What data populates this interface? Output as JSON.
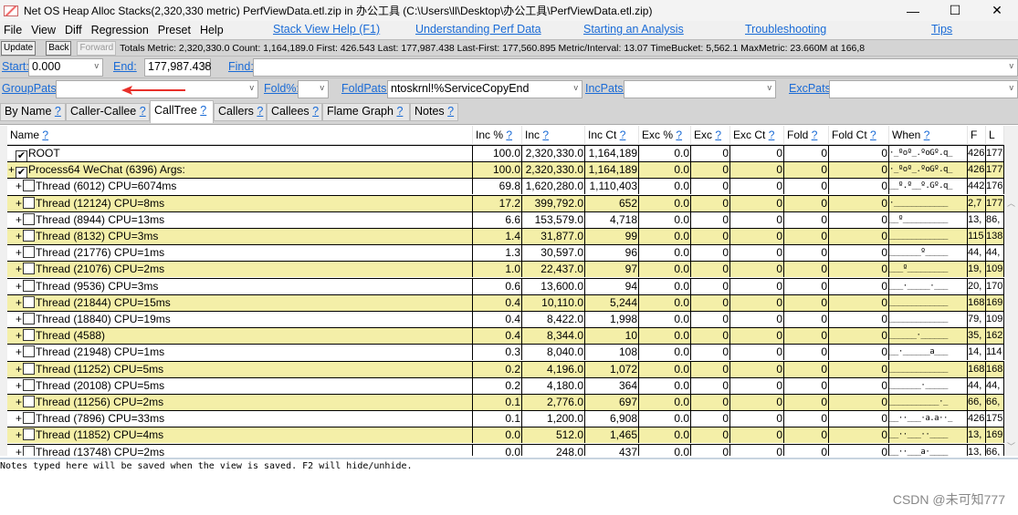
{
  "window": {
    "title": "Net OS Heap Alloc Stacks(2,320,330 metric) PerfViewData.etl.zip in 办公工具 (C:\\Users\\ll\\Desktop\\办公工具\\PerfViewData.etl.zip)",
    "minimize": "—",
    "maximize": "☐",
    "close": "✕"
  },
  "menu": {
    "items": [
      "File",
      "View",
      "Diff",
      "Regression",
      "Preset",
      "Help"
    ],
    "links": [
      "Stack View Help (F1)",
      "Understanding Perf Data",
      "Starting an Analysis",
      "Troubleshooting",
      "Tips"
    ]
  },
  "toolbar": {
    "update": "Update",
    "back": "Back",
    "forward": "Forward",
    "totals": "Totals Metric: 2,320,330.0  Count: 1,164,189.0  First: 426.543 Last: 177,987.438  Last-First: 177,560.895  Metric/Interval: 13.07  TimeBucket: 5,562.1 MaxMetric: 23.660M at 166,8"
  },
  "filters": {
    "start_label": "Start:",
    "start_value": "0.000",
    "end_label": "End:",
    "end_value": "177,987.438",
    "find_label": "Find:",
    "find_value": "",
    "grouppats_label": "GroupPats:",
    "grouppats_value": "",
    "fold_label": "Fold%:",
    "fold_value": "",
    "foldpats_label": "FoldPats:",
    "foldpats_value": "ntoskrnl!%ServiceCopyEnd",
    "incpats_label": "IncPats:",
    "incpats_value": "",
    "excpats_label": "ExcPats:",
    "excpats_value": ""
  },
  "tabs": [
    {
      "label": "By Name"
    },
    {
      "label": "Caller-Callee"
    },
    {
      "label": "CallTree",
      "active": true
    },
    {
      "label": "Callers"
    },
    {
      "label": "Callees"
    },
    {
      "label": "Flame Graph"
    },
    {
      "label": "Notes"
    }
  ],
  "help_mark": "?",
  "columns": [
    "Name",
    "Inc %",
    "Inc",
    "Inc Ct",
    "Exc %",
    "Exc",
    "Exc Ct",
    "Fold",
    "Fold Ct",
    "When",
    "F",
    "L"
  ],
  "rows": [
    {
      "exp": "",
      "checked": true,
      "indent": 0,
      "name": "ROOT",
      "inc_pct": "100.0",
      "inc": "2,320,330.0",
      "inc_ct": "1,164,189",
      "when": "·_ºoº_.ºoGº.q_",
      "f": "426",
      "l": "177"
    },
    {
      "exp": "+",
      "checked": true,
      "indent": 0,
      "name": "Process64 WeChat (6396) Args:",
      "inc_pct": "100.0",
      "inc": "2,320,330.0",
      "inc_ct": "1,164,189",
      "when": "·_ºoº_.ºoGº.q_",
      "f": "426",
      "l": "177"
    },
    {
      "exp": "+",
      "checked": false,
      "indent": 1,
      "name": "Thread (6012) CPU=6074ms",
      "inc_pct": "69.8",
      "inc": "1,620,280.0",
      "inc_ct": "1,110,403",
      "when": "__º.º__º.Gº.q_",
      "f": "442",
      "l": "176"
    },
    {
      "exp": "+",
      "checked": false,
      "indent": 1,
      "name": "Thread (12124) CPU=8ms",
      "inc_pct": "17.2",
      "inc": "399,792.0",
      "inc_ct": "652",
      "when": "·____________",
      "f": "2,7",
      "l": "177"
    },
    {
      "exp": "+",
      "checked": false,
      "indent": 1,
      "name": "Thread (8944) CPU=13ms",
      "inc_pct": "6.6",
      "inc": "153,579.0",
      "inc_ct": "4,718",
      "when": "__º__________",
      "f": "13,",
      "l": "86,"
    },
    {
      "exp": "+",
      "checked": false,
      "indent": 1,
      "name": "Thread (8132) CPU=3ms",
      "inc_pct": "1.4",
      "inc": "31,877.0",
      "inc_ct": "99",
      "when": "_____________",
      "f": "115",
      "l": "138"
    },
    {
      "exp": "+",
      "checked": false,
      "indent": 1,
      "name": "Thread (21776) CPU=1ms",
      "inc_pct": "1.3",
      "inc": "30,597.0",
      "inc_ct": "96",
      "when": "_______º_____",
      "f": "44,",
      "l": "44,"
    },
    {
      "exp": "+",
      "checked": false,
      "indent": 1,
      "name": "Thread (21076) CPU=2ms",
      "inc_pct": "1.0",
      "inc": "22,437.0",
      "inc_ct": "97",
      "when": "___º_________",
      "f": "19,",
      "l": "109"
    },
    {
      "exp": "+",
      "checked": false,
      "indent": 1,
      "name": "Thread (9536) CPU=3ms",
      "inc_pct": "0.6",
      "inc": "13,600.0",
      "inc_ct": "94",
      "when": "___·_____·___",
      "f": "20,",
      "l": "170"
    },
    {
      "exp": "+",
      "checked": false,
      "indent": 1,
      "name": "Thread (21844) CPU=15ms",
      "inc_pct": "0.4",
      "inc": "10,110.0",
      "inc_ct": "5,244",
      "when": "_____________",
      "f": "168",
      "l": "169"
    },
    {
      "exp": "+",
      "checked": false,
      "indent": 1,
      "name": "Thread (18840) CPU=19ms",
      "inc_pct": "0.4",
      "inc": "8,422.0",
      "inc_ct": "1,998",
      "when": "_____________",
      "f": "79,",
      "l": "109"
    },
    {
      "exp": "+",
      "checked": false,
      "indent": 1,
      "name": "Thread (4588)",
      "inc_pct": "0.4",
      "inc": "8,344.0",
      "inc_ct": "10",
      "when": "______·______",
      "f": "35,",
      "l": "162"
    },
    {
      "exp": "+",
      "checked": false,
      "indent": 1,
      "name": "Thread (21948) CPU=1ms",
      "inc_pct": "0.3",
      "inc": "8,040.0",
      "inc_ct": "108",
      "when": "__·______a___",
      "f": "14,",
      "l": "114"
    },
    {
      "exp": "+",
      "checked": false,
      "indent": 1,
      "name": "Thread (11252) CPU=5ms",
      "inc_pct": "0.2",
      "inc": "4,196.0",
      "inc_ct": "1,072",
      "when": "_____________",
      "f": "168",
      "l": "168"
    },
    {
      "exp": "+",
      "checked": false,
      "indent": 1,
      "name": "Thread (20108) CPU=5ms",
      "inc_pct": "0.2",
      "inc": "4,180.0",
      "inc_ct": "364",
      "when": "_______·_____",
      "f": "44,",
      "l": "44,"
    },
    {
      "exp": "+",
      "checked": false,
      "indent": 1,
      "name": "Thread (11256) CPU=2ms",
      "inc_pct": "0.1",
      "inc": "2,776.0",
      "inc_ct": "697",
      "when": "___________·_",
      "f": "66,",
      "l": "66,"
    },
    {
      "exp": "+",
      "checked": false,
      "indent": 1,
      "name": "Thread (7896) CPU=33ms",
      "inc_pct": "0.1",
      "inc": "1,200.0",
      "inc_ct": "6,908",
      "when": "__··___·a.a··_",
      "f": "426",
      "l": "175"
    },
    {
      "exp": "+",
      "checked": false,
      "indent": 1,
      "name": "Thread (11852) CPU=4ms",
      "inc_pct": "0.0",
      "inc": "512.0",
      "inc_ct": "1,465",
      "when": "__··___··____",
      "f": "13,",
      "l": "169"
    },
    {
      "exp": "+",
      "checked": false,
      "indent": 1,
      "name": "Thread (13748) CPU=2ms",
      "inc_pct": "0.0",
      "inc": "248.0",
      "inc_ct": "437",
      "when": "__··___a·____",
      "f": "13,",
      "l": "66,"
    }
  ],
  "zero_cols": {
    "exc_pct": "0.0",
    "exc": "0",
    "exc_ct": "0",
    "fold": "0",
    "fold_ct": "0"
  },
  "notes": {
    "text": "Notes typed here will be saved when the view is saved. F2 will hide/unhide."
  },
  "watermark": "CSDN @未可知777",
  "colors": {
    "alt_row": "#f4efa8",
    "link": "#1a6bd6",
    "arrow": "#e8302a"
  }
}
